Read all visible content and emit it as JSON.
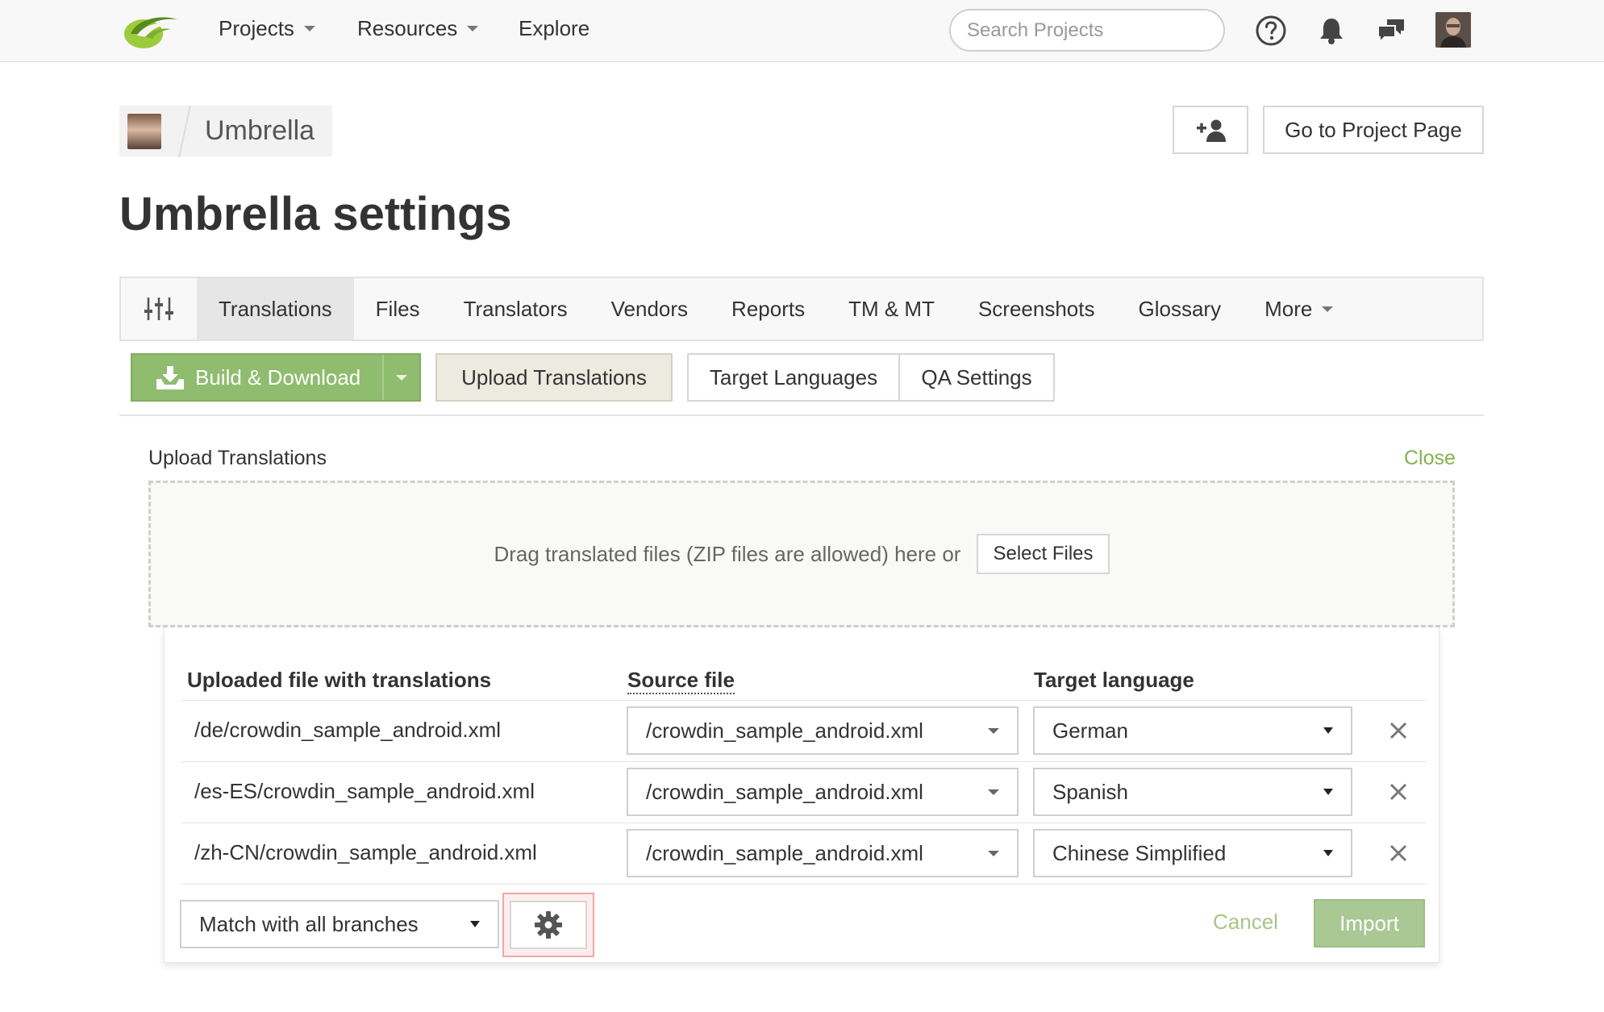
{
  "nav": {
    "items": [
      {
        "label": "Projects",
        "has_caret": true
      },
      {
        "label": "Resources",
        "has_caret": true
      },
      {
        "label": "Explore",
        "has_caret": false
      }
    ],
    "search_placeholder": "Search Projects",
    "icons": [
      "search-icon",
      "help-icon",
      "bell-icon",
      "chat-icon",
      "user-avatar"
    ]
  },
  "project": {
    "name": "Umbrella",
    "add_member_icon": "user-plus-icon",
    "go_to_project_label": "Go to Project Page"
  },
  "page": {
    "title": "Umbrella settings"
  },
  "tabs": [
    {
      "label": "Translations",
      "active": true
    },
    {
      "label": "Files",
      "active": false
    },
    {
      "label": "Translators",
      "active": false
    },
    {
      "label": "Vendors",
      "active": false
    },
    {
      "label": "Reports",
      "active": false
    },
    {
      "label": "TM & MT",
      "active": false
    },
    {
      "label": "Screenshots",
      "active": false
    },
    {
      "label": "Glossary",
      "active": false
    },
    {
      "label": "More",
      "active": false
    }
  ],
  "toolbar": {
    "build_download_label": "Build & Download",
    "upload_translations_label": "Upload Translations",
    "target_languages_label": "Target Languages",
    "qa_settings_label": "QA Settings"
  },
  "upload": {
    "title": "Upload Translations",
    "close_label": "Close",
    "drop_text": "Drag translated files (ZIP files are allowed) here or",
    "select_files_label": "Select Files",
    "columns": {
      "uploaded": "Uploaded file with translations",
      "source": "Source file",
      "target": "Target language"
    },
    "rows": [
      {
        "uploaded": "/de/crowdin_sample_android.xml",
        "source": "/crowdin_sample_android.xml",
        "target": "German"
      },
      {
        "uploaded": "/es-ES/crowdin_sample_android.xml",
        "source": "/crowdin_sample_android.xml",
        "target": "Spanish"
      },
      {
        "uploaded": "/zh-CN/crowdin_sample_android.xml",
        "source": "/crowdin_sample_android.xml",
        "target": "Chinese Simplified"
      }
    ],
    "branch_option": "Match with all branches",
    "cancel_label": "Cancel",
    "import_label": "Import"
  },
  "colors": {
    "accent_green": "#8fbc6e",
    "link_green": "#82b34e",
    "highlight_red": "#f3a5a5"
  }
}
